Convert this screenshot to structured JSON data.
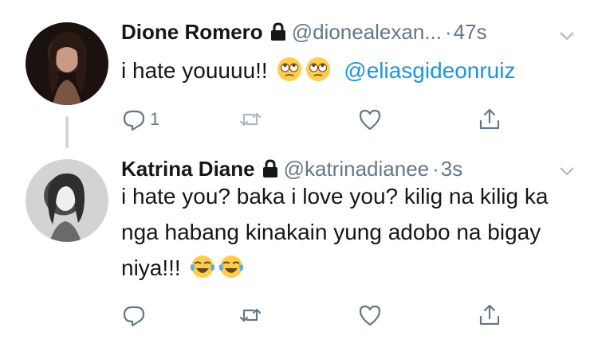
{
  "tweets": [
    {
      "name": "Dione Romero",
      "handle": "@dionealexan...",
      "separator": "·",
      "time": "47s",
      "text": "i hate youuuu!!",
      "emojis": [
        "face-with-rolling-eyes-emoji",
        "face-with-rolling-eyes-emoji"
      ],
      "mention": "@eliasgideonruiz",
      "reply_count": "1",
      "protected": true
    },
    {
      "name": "Katrina Diane",
      "handle": "@katrinadianee",
      "separator": "·",
      "time": "3s",
      "text": "i hate you? baka i love you? kilig na kilig ka nga habang kinakain yung adobo na bigay niya!!!",
      "emojis": [
        "face-with-tears-of-joy-emoji",
        "face-with-tears-of-joy-emoji"
      ],
      "reply_count": "",
      "protected": true
    }
  ],
  "colors": {
    "text": "#14171a",
    "secondary": "#657786",
    "link": "#1b95e0",
    "thread_line": "#cfd6dc"
  },
  "icons": [
    "lock-icon",
    "chevron-down-icon",
    "reply-icon",
    "retweet-icon",
    "like-icon",
    "share-icon"
  ]
}
